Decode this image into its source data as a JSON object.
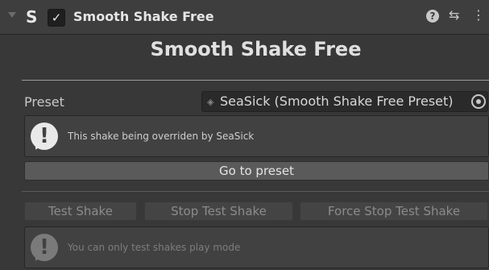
{
  "header": {
    "title": "Smooth Shake Free",
    "enabled": true,
    "icons": [
      "foldout-arrow-icon",
      "script-icon",
      "checkbox-check-icon",
      "help-icon",
      "settings-icon",
      "menu-icon"
    ],
    "script_glyph": "S",
    "check_glyph": "✓",
    "help_glyph": "?",
    "settings_glyph": "⇆",
    "menu_glyph": "⋮"
  },
  "main": {
    "title": "Smooth Shake Free",
    "preset": {
      "label": "Preset",
      "value": "SeaSick (Smooth Shake Free Preset)",
      "asset_glyph": "◈"
    },
    "override_help": {
      "text": "This shake being overriden by SeaSick",
      "icon_glyph": "!"
    },
    "goto_button": "Go to preset",
    "test_buttons": {
      "test": "Test Shake",
      "stop": "Stop Test Shake",
      "force_stop": "Force Stop Test Shake"
    },
    "play_mode_help": {
      "text": "You can only test shakes play mode",
      "icon_glyph": "!"
    }
  },
  "colors": {
    "background": "#383838",
    "header": "#3e3e3e",
    "button": "#585858",
    "disabled_button": "#444444"
  }
}
